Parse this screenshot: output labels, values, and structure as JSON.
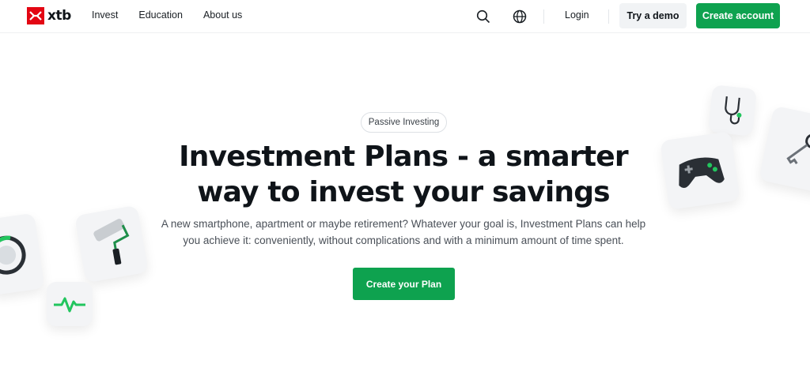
{
  "brand": {
    "name": "xtb",
    "accent": "#e30613",
    "primary_green": "#0ea24f"
  },
  "nav": {
    "items": [
      "Invest",
      "Education",
      "About us"
    ]
  },
  "header": {
    "search_icon": "search-icon",
    "language_icon": "globe-icon",
    "login": "Login",
    "demo": "Try a demo",
    "create_account": "Create account"
  },
  "hero": {
    "badge": "Passive Investing",
    "title_line1": "Investment Plans - a smarter",
    "title_line2": "way to invest your savings",
    "subtitle_line1": "A new smartphone, apartment or maybe retirement? Whatever your goal is, Investment Plans can help",
    "subtitle_line2": "you achieve it: conveniently, without complications and with a minimum amount of time spent.",
    "cta": "Create your Plan"
  },
  "decorations": [
    "dial-icon",
    "paint-roller-icon",
    "heartbeat-icon",
    "stethoscope-icon",
    "gamepad-icon",
    "keys-icon"
  ]
}
